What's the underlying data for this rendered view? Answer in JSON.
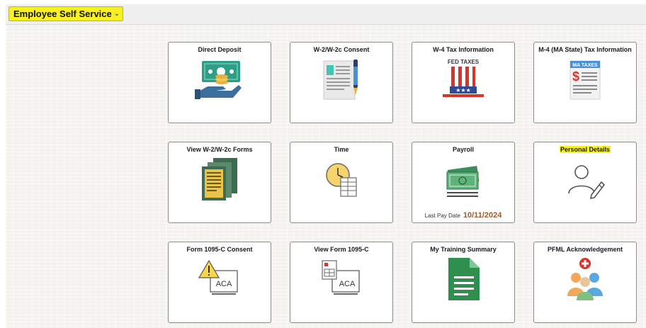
{
  "header": {
    "title": "Employee Self Service",
    "chevron": "⌄"
  },
  "tiles": [
    {
      "label": "Direct Deposit",
      "icon": "money-hand-icon"
    },
    {
      "label": "W-2/W-2c Consent",
      "icon": "document-pen-icon"
    },
    {
      "label": "W-4 Tax Information",
      "icon": "uncle-sam-hat-icon",
      "icon_text": "FED TAXES"
    },
    {
      "label": "M-4 (MA State) Tax Information",
      "icon": "state-tax-document-icon",
      "icon_text": "MA TAXES"
    },
    {
      "label": "View W-2/W-2c Forms",
      "icon": "stacked-forms-icon"
    },
    {
      "label": "Time",
      "icon": "clock-timesheet-icon"
    },
    {
      "label": "Payroll",
      "icon": "cash-bill-icon",
      "sub_label": "Last Pay Date",
      "sub_value": "10/11/2024"
    },
    {
      "label": "Personal Details",
      "icon": "person-edit-icon",
      "highlighted": true
    },
    {
      "label": "Form 1095-C Consent",
      "icon": "warning-aca-icon",
      "icon_text": "ACA"
    },
    {
      "label": "View Form 1095-C",
      "icon": "form-aca-icon",
      "icon_text": "ACA"
    },
    {
      "label": "My Training Summary",
      "icon": "green-document-icon"
    },
    {
      "label": "PFML Acknowledgement",
      "icon": "people-medical-icon"
    }
  ],
  "colors": {
    "highlight": "#f7f022",
    "pay_date": "#a05a2c"
  }
}
